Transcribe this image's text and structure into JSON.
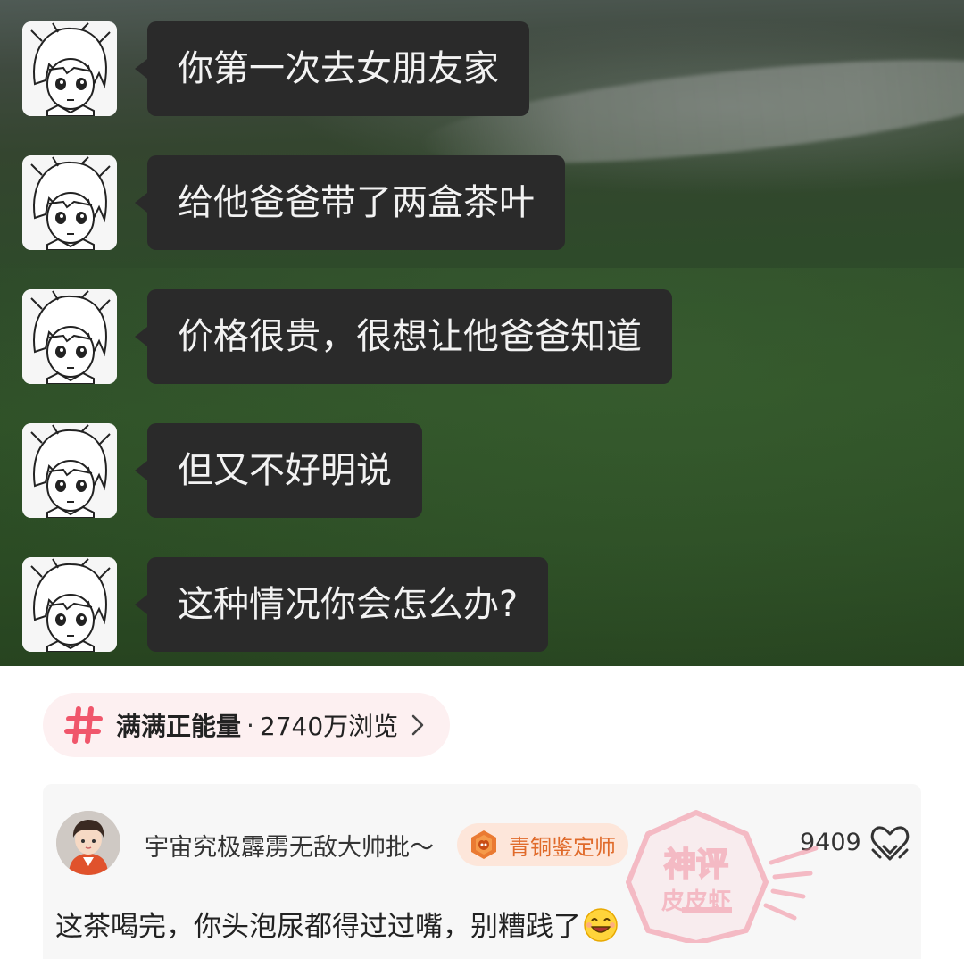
{
  "chat": {
    "messages": [
      {
        "text": "你第一次去女朋友家"
      },
      {
        "text": "给他爸爸带了两盒茶叶"
      },
      {
        "text": "价格很贵，很想让他爸爸知道"
      },
      {
        "text": "但又不好明说"
      },
      {
        "text": "这种情况你会怎么办?"
      }
    ]
  },
  "topic": {
    "icon": "hash-icon",
    "name": "满满正能量",
    "separator": "·",
    "views": "2740万浏览"
  },
  "comment": {
    "username": "宇宙究极霹雳无敌大帅批～",
    "badge": "青铜鉴定师",
    "like_count": "9409",
    "text": "这茶喝完，你头泡尿都得过过嘴，别糟践了",
    "emoji": "laugh-emoji"
  },
  "watermark": {
    "line1": "神评",
    "line2": "皮皮虾"
  },
  "colors": {
    "bubble": "#2a2a2a",
    "topic_pill": "#fdf0f1",
    "hash": "#f0566b",
    "badge_bg": "#fde6da",
    "badge_text": "#e06a2a",
    "card_bg": "#f7f7f7"
  }
}
